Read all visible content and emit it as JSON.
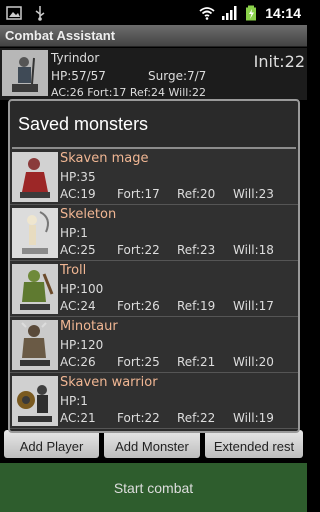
{
  "status_bar": {
    "time": "14:14"
  },
  "app": {
    "title": "Combat Assistant"
  },
  "player": {
    "name": "Tyrindor",
    "hp": "HP:57/57",
    "surge": "Surge:7/7",
    "init": "Init:22",
    "stats": "AC:26      Fort:17      Ref:24      Will:22"
  },
  "dialog": {
    "title": "Saved monsters",
    "monsters": [
      {
        "name": "Skaven mage",
        "hp": "HP:35",
        "ac": "AC:19",
        "fort": "Fort:17",
        "ref": "Ref:20",
        "will": "Will:23"
      },
      {
        "name": "Skeleton",
        "hp": "HP:1",
        "ac": "AC:25",
        "fort": "Fort:22",
        "ref": "Ref:23",
        "will": "Will:18"
      },
      {
        "name": "Troll",
        "hp": "HP:100",
        "ac": "AC:24",
        "fort": "Fort:26",
        "ref": "Ref:19",
        "will": "Will:17"
      },
      {
        "name": "Minotaur",
        "hp": "HP:120",
        "ac": "AC:26",
        "fort": "Fort:25",
        "ref": "Ref:21",
        "will": "Will:20"
      },
      {
        "name": "Skaven warrior",
        "hp": "HP:1",
        "ac": "AC:21",
        "fort": "Fort:22",
        "ref": "Ref:22",
        "will": "Will:19"
      }
    ]
  },
  "buttons": {
    "add_player": "Add Player",
    "add_monster": "Add Monster",
    "extended_rest": "Extended rest",
    "start_combat": "Start combat"
  }
}
